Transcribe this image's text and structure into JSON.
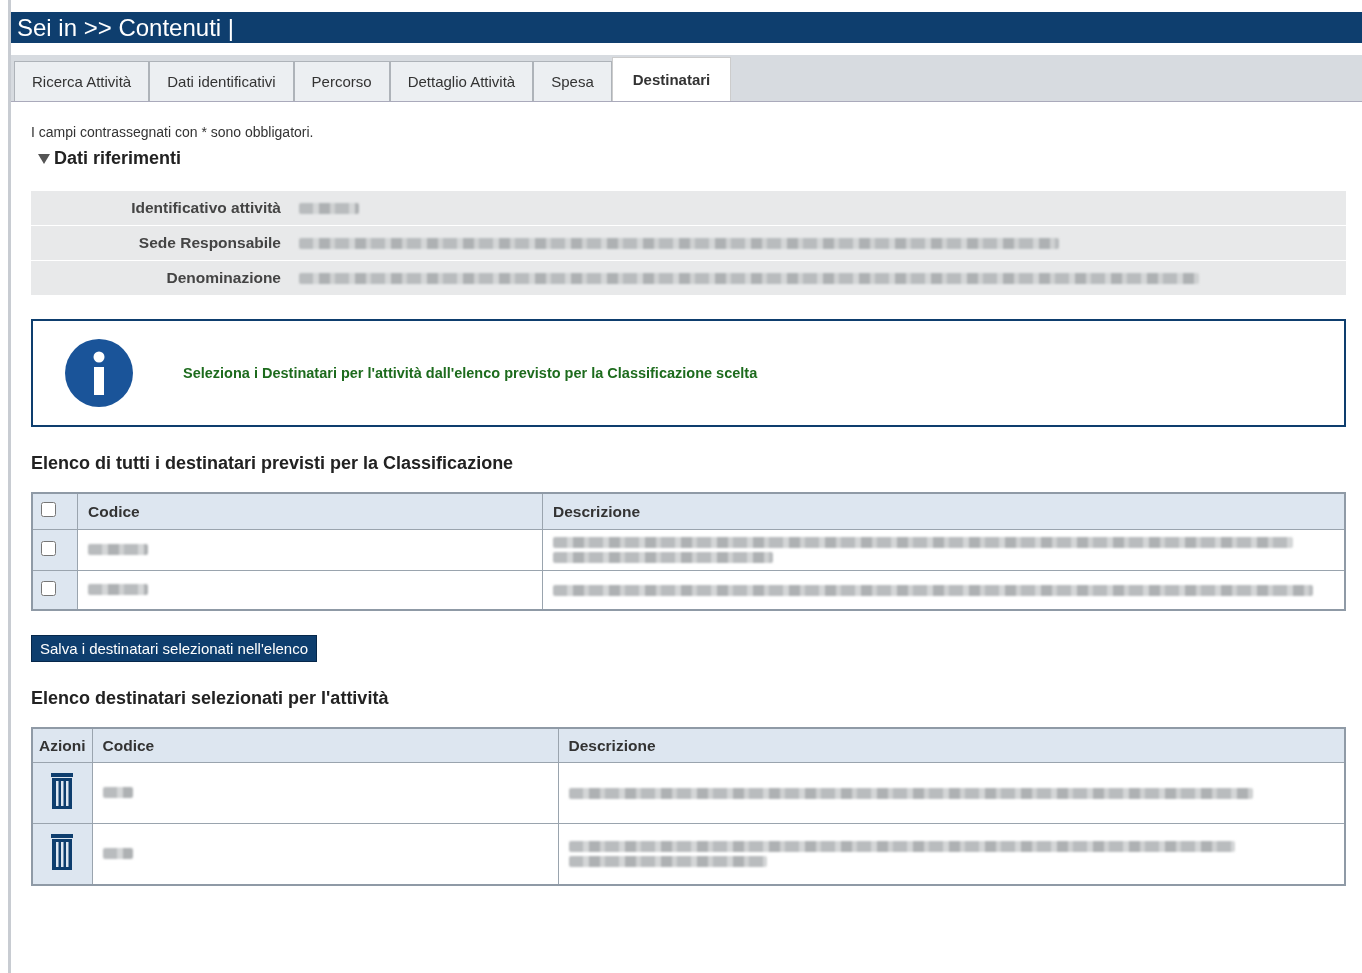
{
  "header": {
    "title": "Sei in >> Contenuti |"
  },
  "tabs": [
    {
      "label": "Ricerca Attività",
      "selected": false
    },
    {
      "label": "Dati identificativi",
      "selected": false
    },
    {
      "label": "Percorso",
      "selected": false
    },
    {
      "label": "Dettaglio Attività",
      "selected": false
    },
    {
      "label": "Spesa",
      "selected": false
    },
    {
      "label": "Destinatari",
      "selected": true
    }
  ],
  "required_note": "I campi contrassegnati con * sono obbligatori.",
  "section": {
    "title": "Dati riferimenti",
    "expanded": true,
    "fields": [
      {
        "label": "Identificativo attività",
        "value": {
          "kind": "redacted_short"
        }
      },
      {
        "label": "Sede Responsabile",
        "value": {
          "kind": "redacted_line"
        }
      },
      {
        "label": "Denominazione",
        "value": {
          "kind": "redacted_wide"
        }
      }
    ]
  },
  "info": {
    "message": "Seleziona i Destinatari per l'attività dall'elenco previsto per la Classificazione scelta"
  },
  "available": {
    "title": "Elenco di tutti i destinatari previsti per la Classificazione",
    "select_all_checked": false,
    "columns": [
      "Codice",
      "Descrizione"
    ],
    "rows": [
      {
        "checked": false,
        "codice": {
          "kind": "redacted_short"
        },
        "descrizione": {
          "kind": "redacted_two_lines"
        }
      },
      {
        "checked": false,
        "codice": {
          "kind": "redacted_short"
        },
        "descrizione": {
          "kind": "redacted_line"
        }
      }
    ]
  },
  "save_button": "Salva i destinatari selezionati nell'elenco",
  "selected": {
    "title": "Elenco destinatari selezionati per l'attività",
    "columns": [
      "Azioni",
      "Codice",
      "Descrizione"
    ],
    "rows": [
      {
        "codice": {
          "kind": "redacted_short"
        },
        "descrizione": {
          "kind": "redacted_line"
        }
      },
      {
        "codice": {
          "kind": "redacted_short"
        },
        "descrizione": {
          "kind": "redacted_two_lines"
        }
      }
    ]
  }
}
